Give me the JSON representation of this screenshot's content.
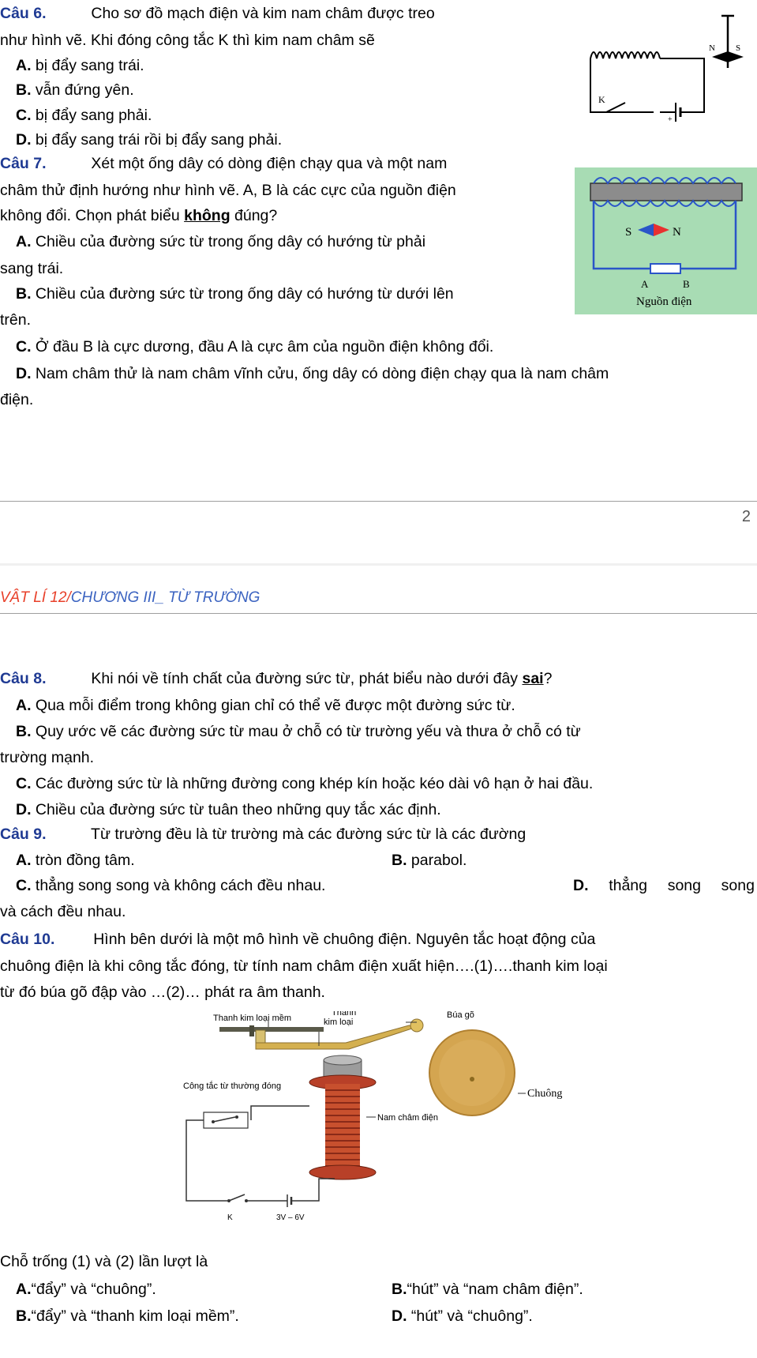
{
  "q6": {
    "label": "Câu 6.",
    "stem1": "Cho sơ đồ mạch điện và kim nam châm được treo",
    "stem2": "như hình vẽ. Khi đóng công tắc K thì kim nam châm sẽ",
    "a_label": "A.",
    "a": "bị đẩy sang trái.",
    "b_label": "B.",
    "b": "vẫn đứng yên.",
    "c_label": "C.",
    "c": "bị đẩy sang phải.",
    "d_label": "D.",
    "d": "bị đẩy sang trái rồi bị đẩy sang phải.",
    "fig": {
      "n": "N",
      "s": "S",
      "k": "K",
      "plus": "+"
    }
  },
  "q7": {
    "label": "Câu 7.",
    "stem1": "Xét một ống dây có dòng điện chạy qua và một nam",
    "stem2": "châm thử định hướng như hình vẽ. A, B là các cực của nguồn điện",
    "stem3a": "không đổi. Chọn phát biểu ",
    "stem3b": "không",
    "stem3c": " đúng?",
    "a_label": "A.",
    "a1": "Chiều của đường sức từ trong ống dây có hướng từ phải",
    "a2": "sang trái.",
    "b_label": "B.",
    "b1": "Chiều của đường sức từ trong ống dây có hướng từ dưới lên",
    "b2": "trên.",
    "c_label": "C.",
    "c": "Ở đầu B là cực dương, đầu A là cực âm của nguồn điện không đổi.",
    "d_label": "D.",
    "d1": "Nam châm thử là nam châm vĩnh cửu, ống dây có dòng điện chạy qua là nam châm",
    "d2": "điện.",
    "fig": {
      "s": "S",
      "n": "N",
      "a": "A",
      "b": "B",
      "source": "Nguồn điện"
    }
  },
  "page_number": "2",
  "header": {
    "part1": "VẬT LÍ 12/",
    "part2": "CHƯƠNG III_ TỪ TRƯỜNG"
  },
  "q8": {
    "label": "Câu 8.",
    "stem_a": "Khi nói về tính chất của đường sức từ, phát biểu nào dưới đây ",
    "stem_b": "sai",
    "stem_c": "?",
    "a_label": "A.",
    "a": "Qua mỗi điểm trong không gian chỉ có thể vẽ được một đường sức từ.",
    "b_label": "B.",
    "b1": "Quy ước vẽ các đường sức từ mau ở chỗ có từ trường yếu và thưa ở chỗ có từ",
    "b2": "trường mạnh.",
    "c_label": "C.",
    "c": "Các đường sức từ là những đường cong khép kín hoặc kéo dài vô hạn ở hai đầu.",
    "d_label": "D.",
    "d": "Chiều của đường sức từ tuân theo những quy tắc xác định."
  },
  "q9": {
    "label": "Câu 9.",
    "stem": "Từ trường đều là từ trường mà các đường sức từ là các đường",
    "a_label": "A.",
    "a": "tròn đồng tâm.",
    "b_label": "B.",
    "b": "parabol.",
    "c_label": "C.",
    "c": "thẳng song song và không cách đều nhau.",
    "d_label": "D.",
    "d1": "thẳng",
    "d2": "song",
    "d3": "song",
    "d4": "và cách đều nhau."
  },
  "q10": {
    "label": "Câu 10.",
    "stem1": "Hình bên dưới là một mô hình về chuông điện. Nguyên tắc hoạt động của",
    "stem2": "chuông điện là khi công tắc đóng, từ tính nam châm điện xuất hiện….(1)….thanh kim loại",
    "stem3": "từ đó búa gõ đập vào …(2)… phát ra âm thanh.",
    "fig": {
      "soft_iron": "Thanh kim loại mềm",
      "metal_bar_1": "Thanh",
      "metal_bar_2": "kim loại",
      "hammer": "Búa gõ",
      "bell": "Chuông",
      "electromagnet": "Nam châm điện",
      "contact": "Công tắc từ thường đóng",
      "k": "K",
      "voltage": "3V – 6V"
    },
    "question": "Chỗ trống (1) và (2) lần lượt là",
    "a_label": "A.",
    "a": "“đẩy” và “chuông”.",
    "b_label": "B.",
    "b": "“hút” và “nam châm điện”.",
    "b2_label": "B.",
    "b2": "“đẩy” và “thanh kim loại mềm”.",
    "d_label": "D.",
    "d": "“hút” và “chuông”."
  }
}
